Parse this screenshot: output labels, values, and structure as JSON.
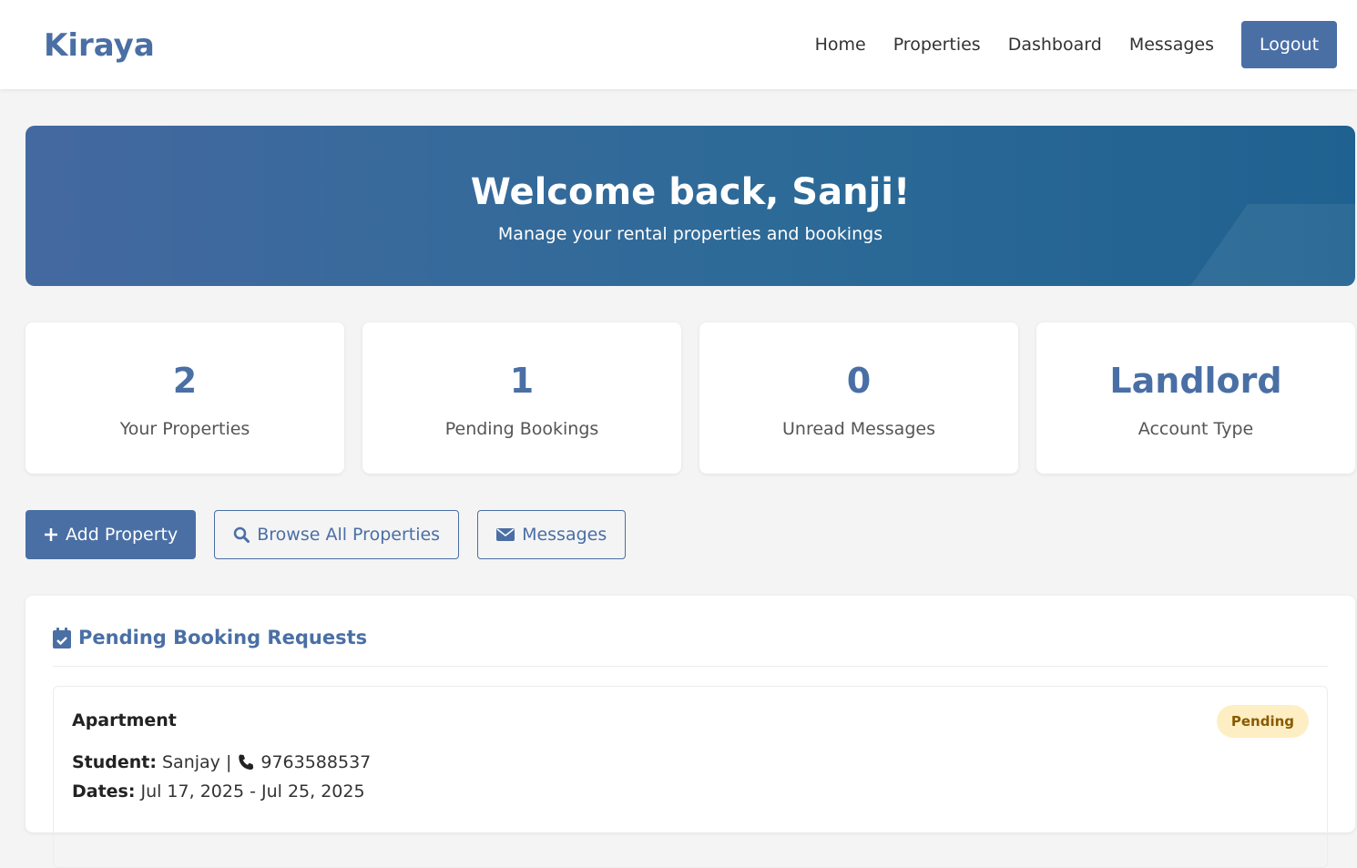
{
  "nav": {
    "brand": "Kiraya",
    "links": [
      "Home",
      "Properties",
      "Dashboard",
      "Messages"
    ],
    "logout": "Logout"
  },
  "hero": {
    "title": "Welcome back, Sanji!",
    "subtitle": "Manage your rental properties and bookings"
  },
  "stats": [
    {
      "value": "2",
      "label": "Your Properties"
    },
    {
      "value": "1",
      "label": "Pending Bookings"
    },
    {
      "value": "0",
      "label": "Unread Messages"
    },
    {
      "value": "Landlord",
      "label": "Account Type"
    }
  ],
  "actions": {
    "add": "Add Property",
    "browse": "Browse All Properties",
    "messages": "Messages"
  },
  "pending": {
    "title": "Pending Booking Requests",
    "booking": {
      "property": "Apartment",
      "status": "Pending",
      "student_label": "Student:",
      "student": "Sanjay |",
      "phone": "9763588537",
      "dates_label": "Dates:",
      "dates": "Jul 17, 2025 - Jul 25, 2025"
    }
  },
  "colors": {
    "accent": "#4a6fa5",
    "badge_bg": "#fdefc3",
    "badge_text": "#8a5a00"
  }
}
